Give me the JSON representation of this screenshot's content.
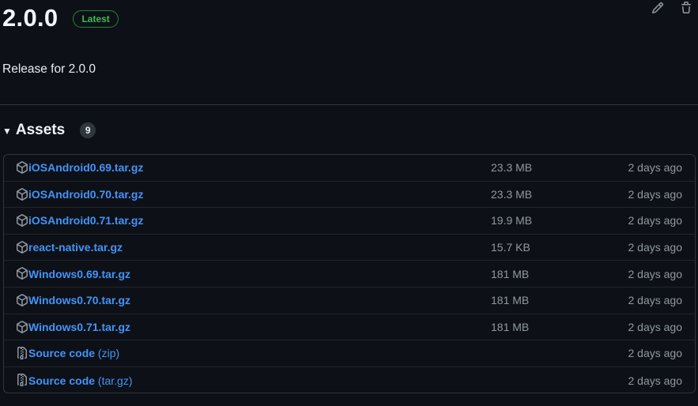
{
  "release": {
    "version": "2.0.0",
    "badge": "Latest",
    "description": "Release for 2.0.0"
  },
  "actions": {
    "edit_icon": "pencil-icon",
    "delete_icon": "trash-icon"
  },
  "assets": {
    "title": "Assets",
    "count": "9",
    "items": [
      {
        "name": "iOSAndroid0.69.tar.gz",
        "suffix": "",
        "size": "23.3 MB",
        "date": "2 days ago",
        "icon": "package-icon"
      },
      {
        "name": "iOSAndroid0.70.tar.gz",
        "suffix": "",
        "size": "23.3 MB",
        "date": "2 days ago",
        "icon": "package-icon"
      },
      {
        "name": "iOSAndroid0.71.tar.gz",
        "suffix": "",
        "size": "19.9 MB",
        "date": "2 days ago",
        "icon": "package-icon"
      },
      {
        "name": "react-native.tar.gz",
        "suffix": "",
        "size": "15.7 KB",
        "date": "2 days ago",
        "icon": "package-icon"
      },
      {
        "name": "Windows0.69.tar.gz",
        "suffix": "",
        "size": "181 MB",
        "date": "2 days ago",
        "icon": "package-icon"
      },
      {
        "name": "Windows0.70.tar.gz",
        "suffix": "",
        "size": "181 MB",
        "date": "2 days ago",
        "icon": "package-icon"
      },
      {
        "name": "Windows0.71.tar.gz",
        "suffix": "",
        "size": "181 MB",
        "date": "2 days ago",
        "icon": "package-icon"
      },
      {
        "name": "Source code",
        "suffix": " (zip)",
        "size": "",
        "date": "2 days ago",
        "icon": "file-zip-icon"
      },
      {
        "name": "Source code",
        "suffix": " (tar.gz)",
        "size": "",
        "date": "2 days ago",
        "icon": "file-zip-icon"
      }
    ]
  },
  "colors": {
    "background": "#0d1117",
    "link": "#4493f8",
    "badge_green": "#3fb950",
    "muted": "#9198a1",
    "border": "#30363d"
  }
}
